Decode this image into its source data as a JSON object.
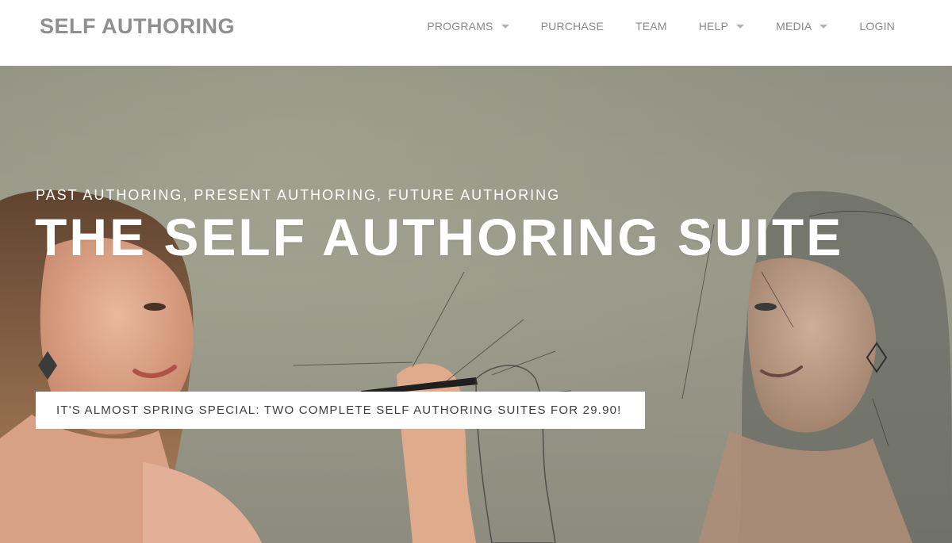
{
  "header": {
    "logo": "SELF AUTHORING",
    "nav": [
      {
        "label": "PROGRAMS",
        "has_dropdown": true
      },
      {
        "label": "PURCHASE",
        "has_dropdown": false
      },
      {
        "label": "TEAM",
        "has_dropdown": false
      },
      {
        "label": "HELP",
        "has_dropdown": true
      },
      {
        "label": "MEDIA",
        "has_dropdown": true
      },
      {
        "label": "LOGIN",
        "has_dropdown": false
      }
    ]
  },
  "hero": {
    "subtitle": "PAST AUTHORING, PRESENT AUTHORING, FUTURE AUTHORING",
    "title": "THE SELF AUTHORING SUITE",
    "promo": "IT'S ALMOST SPRING SPECIAL: TWO COMPLETE SELF AUTHORING SUITES FOR 29.90!"
  },
  "colors": {
    "logo": "#8f8f8f",
    "nav_text": "#8a8a8a",
    "hero_text": "#ffffff",
    "promo_text": "#3d3d3d"
  }
}
